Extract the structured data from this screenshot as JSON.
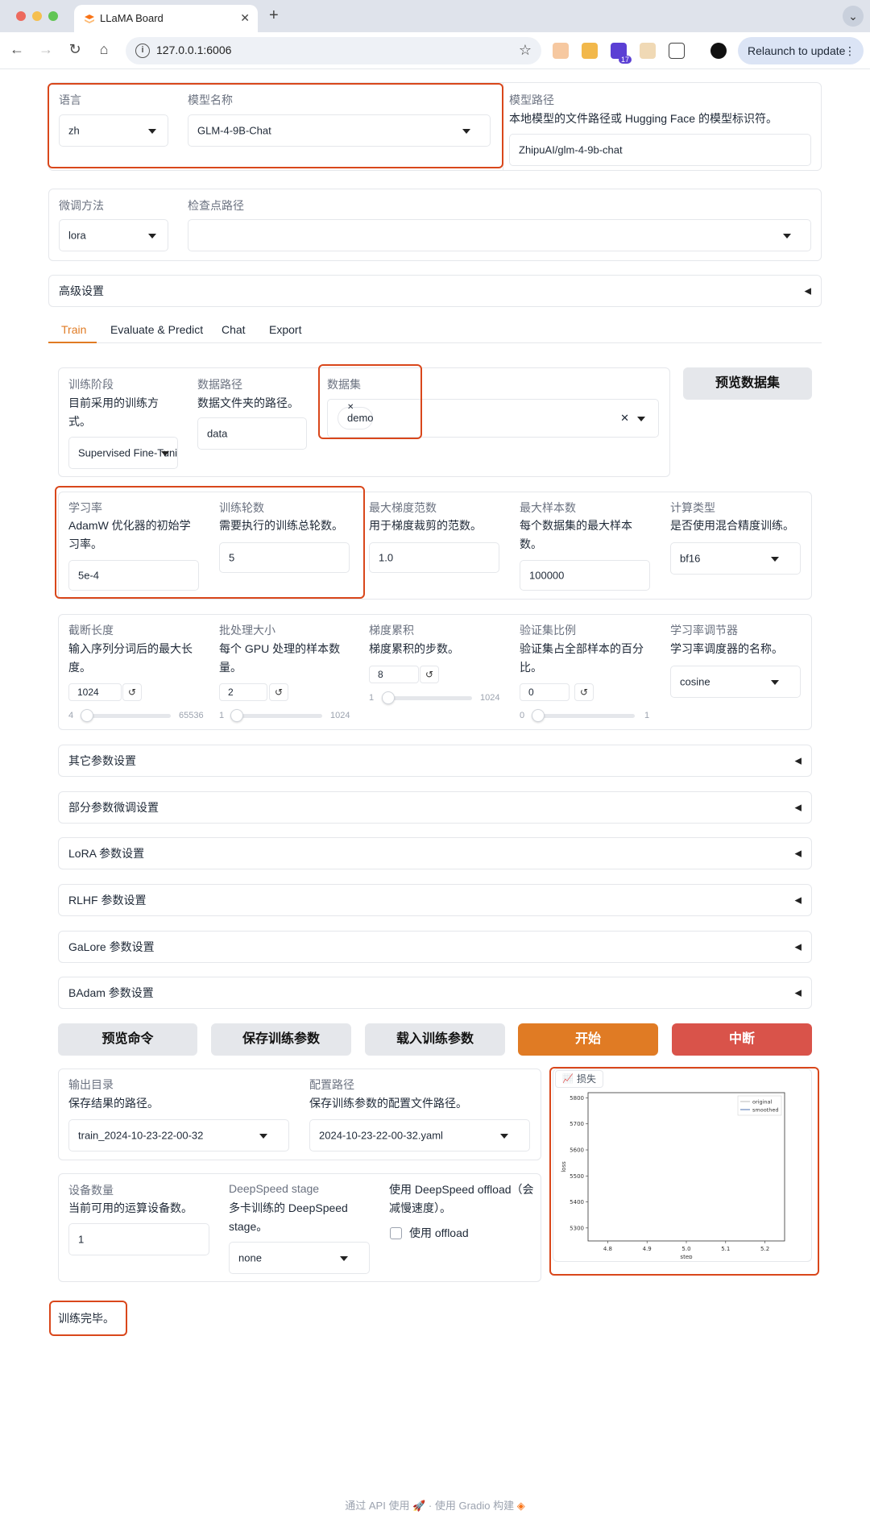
{
  "browser": {
    "tab_title": "LLaMA Board",
    "url": "127.0.0.1:6006",
    "relaunch_label": "Relaunch to update",
    "ext_badge": "17"
  },
  "top": {
    "language": {
      "label": "语言",
      "value": "zh"
    },
    "model_name": {
      "label": "模型名称",
      "value": "GLM-4-9B-Chat"
    },
    "model_path": {
      "label": "模型路径",
      "info": "本地模型的文件路径或 Hugging Face 的模型标识符。",
      "value": "ZhipuAI/glm-4-9b-chat"
    },
    "finetune": {
      "label": "微调方法",
      "value": "lora"
    },
    "checkpoint": {
      "label": "检查点路径",
      "value": ""
    },
    "advanced": "高级设置"
  },
  "tabs": [
    "Train",
    "Evaluate & Predict",
    "Chat",
    "Export"
  ],
  "train": {
    "stage": {
      "label": "训练阶段",
      "info": "目前采用的训练方式。",
      "value": "Supervised Fine-Tuning"
    },
    "dataset_dir": {
      "label": "数据路径",
      "info": "数据文件夹的路径。",
      "value": "data"
    },
    "dataset": {
      "label": "数据集",
      "chip": "demo"
    },
    "preview_dataset": "预览数据集",
    "lr": {
      "label": "学习率",
      "info": "AdamW 优化器的初始学习率。",
      "value": "5e-4"
    },
    "epochs": {
      "label": "训练轮数",
      "info": "需要执行的训练总轮数。",
      "value": "5"
    },
    "max_grad_norm": {
      "label": "最大梯度范数",
      "info": "用于梯度裁剪的范数。",
      "value": "1.0"
    },
    "max_samples": {
      "label": "最大样本数",
      "info": "每个数据集的最大样本数。",
      "value": "100000"
    },
    "compute_type": {
      "label": "计算类型",
      "info": "是否使用混合精度训练。",
      "value": "bf16"
    },
    "cutoff": {
      "label": "截断长度",
      "info": "输入序列分词后的最大长度。",
      "value": "1024",
      "min": "4",
      "max": "65536"
    },
    "batch": {
      "label": "批处理大小",
      "info": "每个 GPU 处理的样本数量。",
      "value": "2",
      "min": "1",
      "max": "1024"
    },
    "grad_accum": {
      "label": "梯度累积",
      "info": "梯度累积的步数。",
      "value": "8",
      "min": "1",
      "max": "1024"
    },
    "val_size": {
      "label": "验证集比例",
      "info": "验证集占全部样本的百分比。",
      "value": "0",
      "min": "0",
      "max": "1"
    },
    "scheduler": {
      "label": "学习率调节器",
      "info": "学习率调度器的名称。",
      "value": "cosine"
    },
    "accordions": [
      "其它参数设置",
      "部分参数微调设置",
      "LoRA 参数设置",
      "RLHF 参数设置",
      "GaLore 参数设置",
      "BAdam 参数设置"
    ],
    "buttons": {
      "preview_cmd": "预览命令",
      "save_args": "保存训练参数",
      "load_args": "载入训练参数",
      "start": "开始",
      "abort": "中断"
    },
    "output_dir": {
      "label": "输出目录",
      "info": "保存结果的路径。",
      "value": "train_2024-10-23-22-00-32"
    },
    "config_path": {
      "label": "配置路径",
      "info": "保存训练参数的配置文件路径。",
      "value": "2024-10-23-22-00-32.yaml"
    },
    "devices": {
      "label": "设备数量",
      "info": "当前可用的运算设备数。",
      "value": "1"
    },
    "ds_stage": {
      "label": "DeepSpeed stage",
      "info": "多卡训练的 DeepSpeed stage。",
      "value": "none"
    },
    "ds_offload": {
      "label": "使用 DeepSpeed offload（会减慢速度）。",
      "checkbox": "使用 offload"
    },
    "loss_label": "损失",
    "status": "训练完毕。"
  },
  "chart_data": {
    "type": "line",
    "xlabel": "step",
    "ylabel": "loss",
    "xticks": [
      "4.8",
      "4.9",
      "5.0",
      "5.1",
      "5.2"
    ],
    "yticks": [
      "5800",
      "5700",
      "5600",
      "5500",
      "5400",
      "5300"
    ],
    "xlim": [
      4.75,
      5.25
    ],
    "ylim": [
      5250,
      5820
    ],
    "series": [
      {
        "name": "original",
        "values": []
      },
      {
        "name": "smoothed",
        "values": []
      }
    ],
    "legend": "top-right"
  },
  "footer": {
    "api": "通过 API 使用",
    "built": "使用 Gradio 构建",
    "sep": "·"
  }
}
